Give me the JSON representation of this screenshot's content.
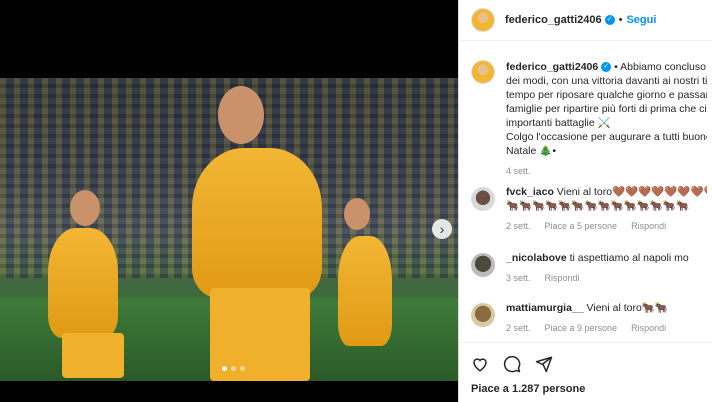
{
  "post": {
    "username": "federico_gatti2406",
    "follow_label": "Segui",
    "separator": "•",
    "caption_lines": [
      "Abbiamo concluso l'",
      "dei modi, con una vittoria davanti ai nostri tifo",
      "tempo per riposare qualche giorno e passarlo",
      "famiglie per ripartire più forti di prima che ci a",
      "importanti battaglie ⚔️",
      "Colgo l'occasione per augurare a tutti buone f",
      "Natale 🎄•"
    ],
    "caption_time": "4 sett."
  },
  "comments": [
    {
      "username": "fvck_iaco",
      "line1": "Vieni al toro🤎🤎🤎🤎🤎🤎🤎🤎🤎",
      "line2": "🐂🐂🐂🐂🐂🐂🐂🐂🐂🐂🐂🐂🐂🐂",
      "time": "2 sett.",
      "likes": "Piace a 5 persone",
      "reply": "Rispondi"
    },
    {
      "username": "_nicolabove",
      "line1": "ti aspettiamo al napoli mo",
      "time": "3 sett.",
      "reply": "Rispondi"
    },
    {
      "username": "mattiamurgia__",
      "line1": "Vieni al toro🐂🐂",
      "time": "2 sett.",
      "likes": "Piace a 9 persone",
      "reply": "Rispondi"
    }
  ],
  "footer": {
    "likes": "Piace a 1.287 persone"
  },
  "icons": [
    "heart-icon",
    "comment-icon",
    "share-icon",
    "chevron-right-icon"
  ],
  "colors": {
    "accent": "#0095f6",
    "muted": "#8e8e8e",
    "text": "#262626"
  }
}
